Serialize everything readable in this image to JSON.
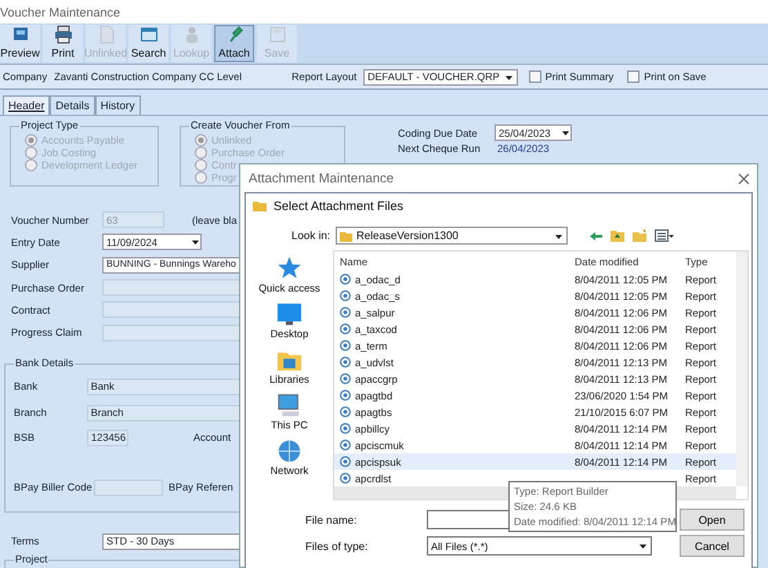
{
  "window": {
    "title": "Voucher Maintenance"
  },
  "toolbar": [
    {
      "label": "Preview",
      "disabled": false,
      "pressed": false
    },
    {
      "label": "Print",
      "disabled": false,
      "pressed": false
    },
    {
      "label": "Unlinked",
      "disabled": true,
      "pressed": false
    },
    {
      "label": "Search",
      "disabled": false,
      "pressed": false
    },
    {
      "label": "Lookup",
      "disabled": true,
      "pressed": false
    },
    {
      "label": "Attach",
      "disabled": false,
      "pressed": true
    },
    {
      "label": "Save",
      "disabled": true,
      "pressed": false
    }
  ],
  "company": {
    "label": "Company",
    "value": "Zavanti Construction Company CC Level"
  },
  "report_layout": {
    "label": "Report Layout",
    "value": "DEFAULT - VOUCHER.QRP"
  },
  "options": [
    {
      "label": "Print Summary",
      "checked": false
    },
    {
      "label": "Print on Save",
      "checked": false
    }
  ],
  "tabs": [
    {
      "label": "Header",
      "selected": true
    },
    {
      "label": "Details",
      "selected": false
    },
    {
      "label": "History",
      "selected": false
    }
  ],
  "project_type": {
    "title": "Project Type",
    "options": [
      {
        "label": "Accounts Payable",
        "selected": true,
        "disabled": true
      },
      {
        "label": "Job Costing",
        "selected": false,
        "disabled": true
      },
      {
        "label": "Development Ledger",
        "selected": false,
        "disabled": true
      }
    ]
  },
  "create_voucher_from": {
    "title": "Create Voucher From",
    "options": [
      {
        "label": "Unlinked",
        "selected": true,
        "disabled": true
      },
      {
        "label": "Purchase Order",
        "selected": false,
        "disabled": true
      },
      {
        "label": "Contr",
        "selected": false,
        "disabled": true
      },
      {
        "label": "Progr",
        "selected": false,
        "disabled": true
      }
    ]
  },
  "coding_due_date": {
    "label": "Coding Due Date",
    "value": "25/04/2023"
  },
  "next_cheque_run": {
    "label": "Next Cheque Run",
    "value": "26/04/2023"
  },
  "fields": [
    {
      "label": "Voucher Number",
      "value": "63",
      "kind": "readonly",
      "note": "(leave bla"
    },
    {
      "label": "Entry Date",
      "value": "11/09/2024",
      "kind": "date"
    },
    {
      "label": "Supplier",
      "value": "BUNNING - Bunnings Wareho",
      "kind": "text"
    },
    {
      "label": "Purchase Order",
      "kind": "readonly"
    },
    {
      "label": "Contract",
      "kind": "readonly"
    },
    {
      "label": "Progress Claim",
      "kind": "readonly"
    }
  ],
  "bank_details": {
    "title": "Bank Details",
    "bank": {
      "label": "Bank",
      "value": "Bank"
    },
    "branch": {
      "label": "Branch",
      "value": "Branch"
    },
    "bsb": {
      "label": "BSB",
      "value": "123456"
    },
    "account_label": "Account",
    "bpay_biller_code_label": "BPay Biller Code",
    "bpay_reference_label": "BPay Referen"
  },
  "terms": {
    "label": "Terms",
    "value": "STD - 30 Days"
  },
  "project_group": {
    "title": "Project"
  },
  "attachment_dialog": {
    "title": "Attachment Maintenance"
  },
  "file_dialog": {
    "title": "Select Attachment Files",
    "look_in": {
      "label": "Look in:",
      "value": "ReleaseVersion1300"
    },
    "places": [
      {
        "label": "Quick access",
        "kind": "star"
      },
      {
        "label": "Desktop",
        "kind": "desktop"
      },
      {
        "label": "Libraries",
        "kind": "library"
      },
      {
        "label": "This PC",
        "kind": "pc"
      },
      {
        "label": "Network",
        "kind": "network"
      }
    ],
    "columns": [
      "Name",
      "Date modified",
      "Type"
    ],
    "files": [
      {
        "name": "a_odac_d",
        "date": "8/04/2011 12:05 PM",
        "type": "Report",
        "selected": false
      },
      {
        "name": "a_odac_s",
        "date": "8/04/2011 12:05 PM",
        "type": "Report",
        "selected": false
      },
      {
        "name": "a_salpur",
        "date": "8/04/2011 12:06 PM",
        "type": "Report",
        "selected": false
      },
      {
        "name": "a_taxcod",
        "date": "8/04/2011 12:06 PM",
        "type": "Report",
        "selected": false
      },
      {
        "name": "a_term",
        "date": "8/04/2011 12:06 PM",
        "type": "Report",
        "selected": false
      },
      {
        "name": "a_udvlst",
        "date": "8/04/2011 12:13 PM",
        "type": "Report",
        "selected": false
      },
      {
        "name": "apaccgrp",
        "date": "8/04/2011 12:13 PM",
        "type": "Report",
        "selected": false
      },
      {
        "name": "apagtbd",
        "date": "23/06/2020 1:54 PM",
        "type": "Report",
        "selected": false
      },
      {
        "name": "apagtbs",
        "date": "21/10/2015 6:07 PM",
        "type": "Report",
        "selected": false
      },
      {
        "name": "apbillcy",
        "date": "8/04/2011 12:14 PM",
        "type": "Report",
        "selected": false
      },
      {
        "name": "apciscmuk",
        "date": "8/04/2011 12:14 PM",
        "type": "Report",
        "selected": false
      },
      {
        "name": "apcispsuk",
        "date": "8/04/2011 12:14 PM",
        "type": "Report",
        "selected": true
      },
      {
        "name": "apcrdlst",
        "type": "Report",
        "selected": false
      }
    ],
    "tooltip": [
      "Type: Report Builder",
      "Size: 24.6 KB",
      "Date modified: 8/04/2011 12:14 PM"
    ],
    "file_name": {
      "label": "File name:"
    },
    "files_of_type": {
      "label": "Files of type:",
      "value": "All Files (*.*)"
    },
    "buttons": [
      "Open",
      "Cancel"
    ]
  }
}
